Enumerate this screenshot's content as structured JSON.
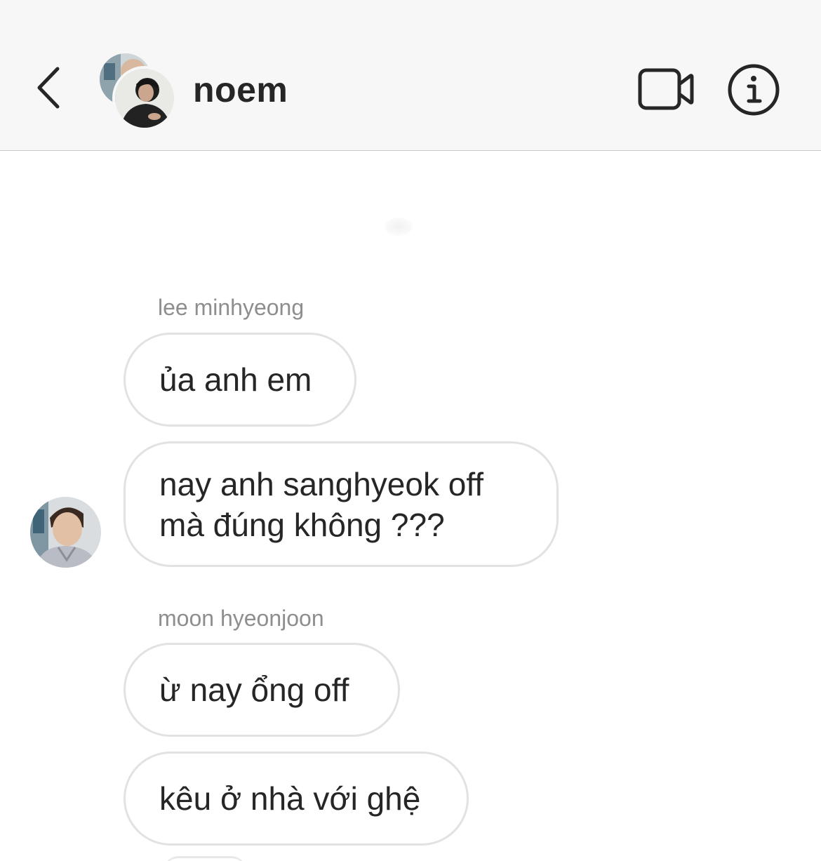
{
  "header": {
    "title": "noem",
    "back_icon": "chevron-left-icon",
    "video_icon": "video-camera-icon",
    "info_icon": "info-circle-icon"
  },
  "messages": [
    {
      "sender": "lee minhyeong"
    },
    {
      "text": "ủa anh em"
    },
    {
      "text": "nay anh sanghyeok off\nmà đúng không ???"
    },
    {
      "sender": "moon hyeonjoon"
    },
    {
      "text": "ừ nay ổng off"
    },
    {
      "text": "kêu ở nhà với ghệ"
    }
  ],
  "colors": {
    "header_bg": "#f7f7f7",
    "text": "#262626",
    "secondary_text": "#8e8e8e",
    "bubble_border": "#e2e2e2",
    "divider": "#c8c8c8"
  }
}
